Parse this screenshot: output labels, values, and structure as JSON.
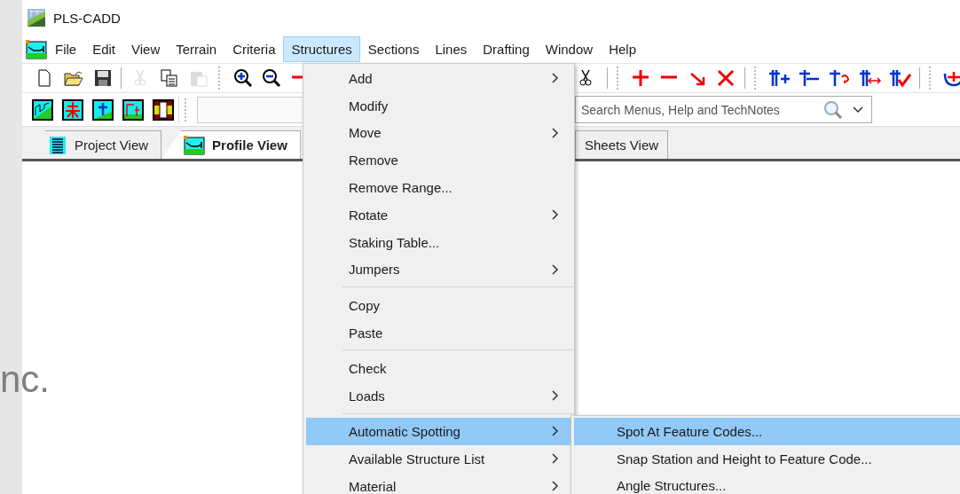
{
  "slide_text": "nc.",
  "window": {
    "title": "PLS-CADD"
  },
  "menu_bar": [
    {
      "label": "File",
      "selected": false
    },
    {
      "label": "Edit",
      "selected": false
    },
    {
      "label": "View",
      "selected": false
    },
    {
      "label": "Terrain",
      "selected": false
    },
    {
      "label": "Criteria",
      "selected": false
    },
    {
      "label": "Structures",
      "selected": true
    },
    {
      "label": "Sections",
      "selected": false
    },
    {
      "label": "Lines",
      "selected": false
    },
    {
      "label": "Drafting",
      "selected": false
    },
    {
      "label": "Window",
      "selected": false
    },
    {
      "label": "Help",
      "selected": false
    }
  ],
  "toolbar": [
    {
      "disabled": false
    },
    {
      "disabled": false
    },
    {
      "disabled": false
    },
    {
      "disabled": true
    },
    {
      "disabled": false
    },
    {
      "disabled": true
    }
  ],
  "search": {
    "placeholder": "Search Menus, Help and TechNotes"
  },
  "tabs": [
    {
      "label": "Project View",
      "selected": false
    },
    {
      "label": "Profile View",
      "selected": true
    },
    {
      "label": "Sheets View",
      "selected": false
    }
  ],
  "structures_menu": [
    {
      "kind": "item",
      "label": "Add",
      "submenu": true,
      "selected": false
    },
    {
      "kind": "item",
      "label": "Modify",
      "submenu": false,
      "selected": false
    },
    {
      "kind": "item",
      "label": "Move",
      "submenu": true,
      "selected": false
    },
    {
      "kind": "item",
      "label": "Remove",
      "submenu": false,
      "selected": false
    },
    {
      "kind": "item",
      "label": "Remove Range...",
      "submenu": false,
      "selected": false
    },
    {
      "kind": "item",
      "label": "Rotate",
      "submenu": true,
      "selected": false
    },
    {
      "kind": "item",
      "label": "Staking Table...",
      "submenu": false,
      "selected": false
    },
    {
      "kind": "item",
      "label": "Jumpers",
      "submenu": true,
      "selected": false
    },
    {
      "kind": "separator"
    },
    {
      "kind": "item",
      "label": "Copy",
      "submenu": false,
      "selected": false
    },
    {
      "kind": "item",
      "label": "Paste",
      "submenu": false,
      "selected": false
    },
    {
      "kind": "separator"
    },
    {
      "kind": "item",
      "label": "Check",
      "submenu": false,
      "selected": false
    },
    {
      "kind": "item",
      "label": "Loads",
      "submenu": true,
      "selected": false
    },
    {
      "kind": "separator"
    },
    {
      "kind": "item",
      "label": "Automatic Spotting",
      "submenu": true,
      "selected": true
    },
    {
      "kind": "item",
      "label": "Available Structure List",
      "submenu": true,
      "selected": false
    },
    {
      "kind": "item",
      "label": "Material",
      "submenu": true,
      "selected": false
    }
  ],
  "automatic_spotting_submenu": [
    {
      "label": "Spot At Feature Codes...",
      "selected": true
    },
    {
      "label": "Snap Station and Height to Feature Code...",
      "selected": false
    },
    {
      "label": "Angle Structures...",
      "selected": false
    }
  ]
}
